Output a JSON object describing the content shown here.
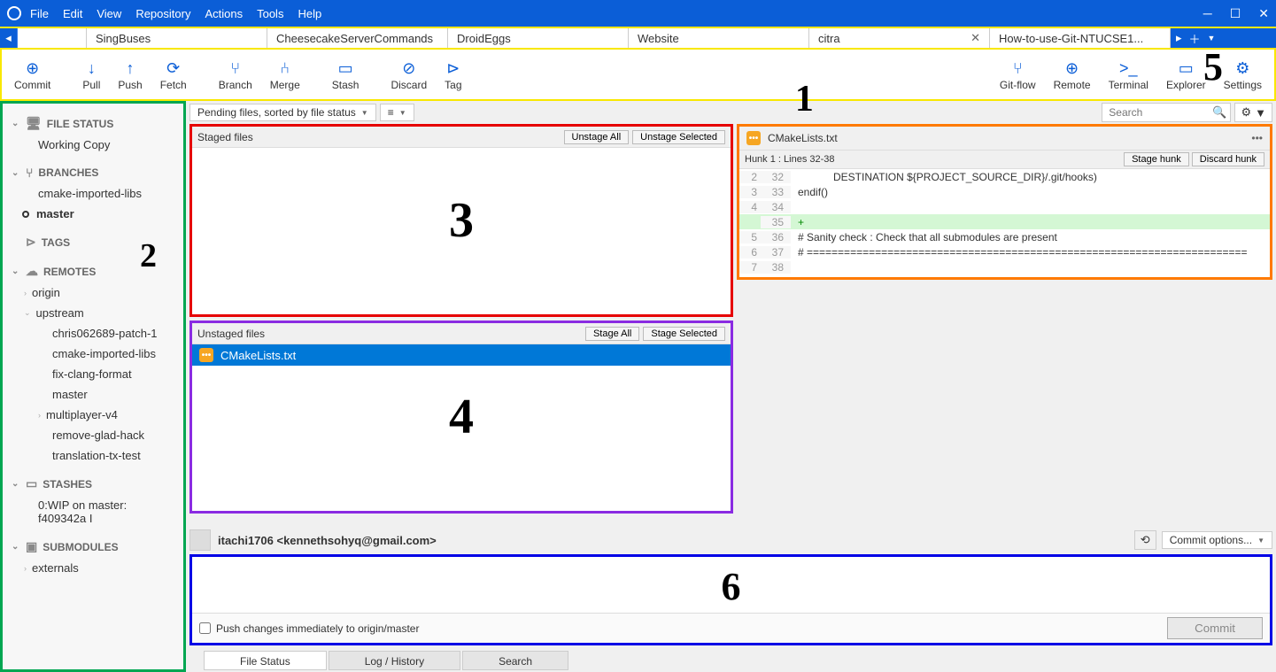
{
  "menu": [
    "File",
    "Edit",
    "View",
    "Repository",
    "Actions",
    "Tools",
    "Help"
  ],
  "tabs": [
    "",
    "SingBuses",
    "CheesecakeServerCommands",
    "DroidEggs",
    "Website",
    "citra",
    "How-to-use-Git-NTUCSE1..."
  ],
  "active_tab_index": 5,
  "toolbar": {
    "left": [
      {
        "label": "Commit",
        "icon": "⊕"
      },
      {
        "label": "Pull",
        "icon": "↓"
      },
      {
        "label": "Push",
        "icon": "↑"
      },
      {
        "label": "Fetch",
        "icon": "⟳"
      },
      {
        "label": "Branch",
        "icon": "⑂"
      },
      {
        "label": "Merge",
        "icon": "⑃"
      },
      {
        "label": "Stash",
        "icon": "▭"
      },
      {
        "label": "Discard",
        "icon": "⊘"
      },
      {
        "label": "Tag",
        "icon": "⊳"
      }
    ],
    "right": [
      {
        "label": "Git-flow",
        "icon": "⑂"
      },
      {
        "label": "Remote",
        "icon": "⊕"
      },
      {
        "label": "Terminal",
        "icon": ">_"
      },
      {
        "label": "Explorer",
        "icon": "▭"
      },
      {
        "label": "Settings",
        "icon": "⚙"
      }
    ]
  },
  "sidebar": {
    "file_status": {
      "title": "FILE STATUS",
      "items": [
        "Working Copy"
      ]
    },
    "branches": {
      "title": "BRANCHES",
      "items": [
        "cmake-imported-libs",
        "master"
      ],
      "current": "master"
    },
    "tags": {
      "title": "TAGS"
    },
    "remotes": {
      "title": "REMOTES",
      "items": [
        {
          "name": "origin",
          "branches": []
        },
        {
          "name": "upstream",
          "branches": [
            "chris062689-patch-1",
            "cmake-imported-libs",
            "fix-clang-format",
            "master",
            "multiplayer-v4",
            "remove-glad-hack",
            "translation-tx-test"
          ]
        }
      ]
    },
    "stashes": {
      "title": "STASHES",
      "items": [
        "0:WIP on master: f409342a I"
      ]
    },
    "submodules": {
      "title": "SUBMODULES",
      "items": [
        "externals"
      ]
    }
  },
  "filter": {
    "label": "Pending files, sorted by file status"
  },
  "search_placeholder": "Search",
  "staged": {
    "title": "Staged files",
    "btn1": "Unstage All",
    "btn2": "Unstage Selected",
    "files": []
  },
  "unstaged": {
    "title": "Unstaged files",
    "btn1": "Stage All",
    "btn2": "Stage Selected",
    "files": [
      "CMakeLists.txt"
    ]
  },
  "diff": {
    "filename": "CMakeLists.txt",
    "hunk_label": "Hunk 1 : Lines 32-38",
    "btn_stage": "Stage hunk",
    "btn_discard": "Discard hunk",
    "lines": [
      {
        "a": "2",
        "b": "32",
        "text": "            DESTINATION ${PROJECT_SOURCE_DIR}/.git/hooks)",
        "type": ""
      },
      {
        "a": "3",
        "b": "33",
        "text": "endif()",
        "type": ""
      },
      {
        "a": "4",
        "b": "34",
        "text": "",
        "type": ""
      },
      {
        "a": "",
        "b": "35",
        "text": "",
        "type": "add"
      },
      {
        "a": "5",
        "b": "36",
        "text": "# Sanity check : Check that all submodules are present",
        "type": ""
      },
      {
        "a": "6",
        "b": "37",
        "text": "# =======================================================================",
        "type": ""
      },
      {
        "a": "7",
        "b": "38",
        "text": "",
        "type": ""
      }
    ]
  },
  "commit": {
    "author": "itachi1706 <kennethsohyq@gmail.com>",
    "options_label": "Commit options...",
    "push_label": "Push changes immediately to origin/master",
    "commit_btn": "Commit"
  },
  "bottom_tabs": [
    "File Status",
    "Log / History",
    "Search"
  ],
  "annotations": [
    "1",
    "2",
    "3",
    "4",
    "5",
    "6"
  ]
}
